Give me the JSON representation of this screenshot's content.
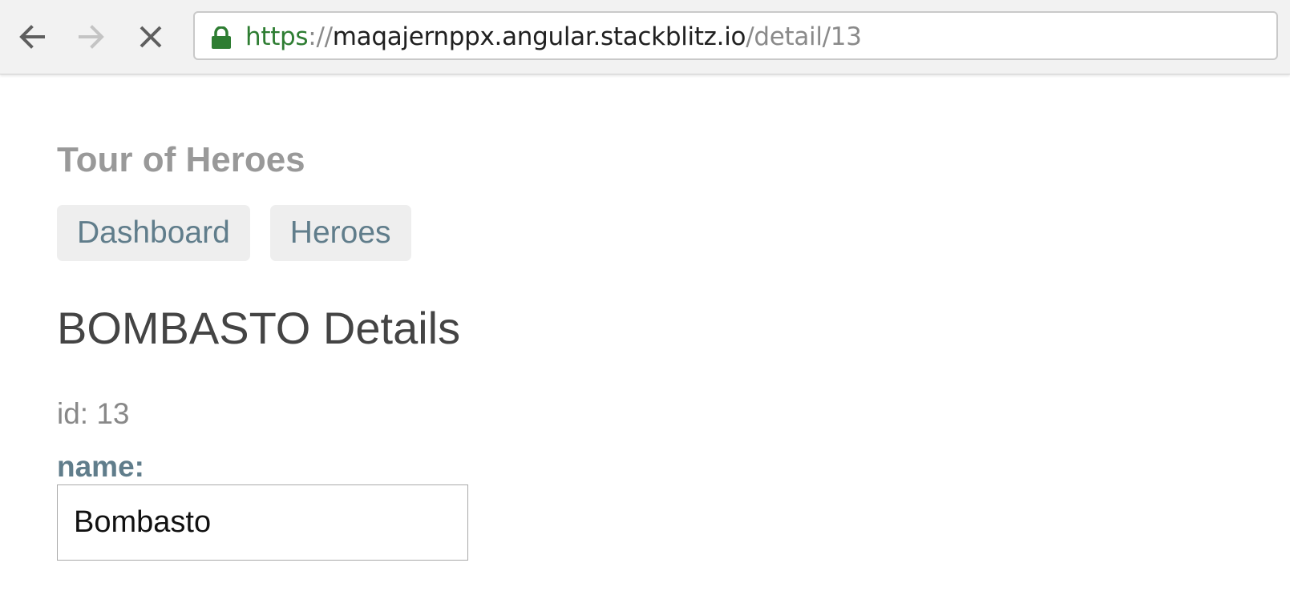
{
  "browser": {
    "back_icon": "arrow-left-icon",
    "forward_icon": "arrow-right-icon",
    "stop_icon": "close-icon",
    "lock_icon": "lock-icon",
    "url": {
      "scheme": "https",
      "separator": "://",
      "host": "maqajernppx.angular.stackblitz.io",
      "path": "/detail/13"
    },
    "colors": {
      "secure": "#2e7d32",
      "muted": "#8a8a8a"
    }
  },
  "app": {
    "title": "Tour of Heroes",
    "nav": [
      {
        "label": "Dashboard"
      },
      {
        "label": "Heroes"
      }
    ],
    "colors": {
      "accent": "#607d8b",
      "nav_bg": "#eeeeee"
    }
  },
  "hero_detail": {
    "heading": "BOMBASTO Details",
    "id_label": "id: 13",
    "name_label": "name:",
    "name_value": "Bombasto"
  }
}
